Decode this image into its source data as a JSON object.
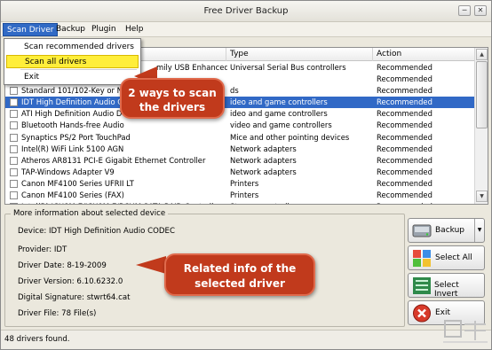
{
  "window": {
    "title": "Free Driver Backup"
  },
  "menu": {
    "items": [
      "Scan Driver",
      "Backup",
      "Plugin",
      "Help"
    ],
    "dropdown": [
      "Scan recommended drivers",
      "Scan all drivers",
      "Exit"
    ]
  },
  "table": {
    "columns": [
      "",
      "Type",
      "Action"
    ],
    "rows": [
      {
        "name": "",
        "name_tail": "mily USB Enhanced...",
        "type": "Universal Serial Bus controllers",
        "action": "Recommended",
        "selected": false
      },
      {
        "name": "",
        "name_tail": "",
        "type": "",
        "action": "Recommended",
        "selected": false
      },
      {
        "name": "Standard 101/102-Key or N",
        "name_tail": "",
        "type": "ds",
        "action": "Recommended",
        "selected": false
      },
      {
        "name": "IDT High Definition Audio C",
        "name_tail": "",
        "type": "ideo and game controllers",
        "action": "Recommended",
        "selected": true
      },
      {
        "name": "ATI High Definition Audio D",
        "name_tail": "",
        "type": "ideo and game controllers",
        "action": "Recommended",
        "selected": false
      },
      {
        "name": "Bluetooth Hands-free Audio",
        "name_tail": "",
        "type": "video and game controllers",
        "action": "Recommended",
        "selected": false
      },
      {
        "name": "Synaptics PS/2 Port TouchPad",
        "name_tail": "",
        "type": "Mice and other pointing devices",
        "action": "Recommended",
        "selected": false
      },
      {
        "name": "Intel(R) WiFi Link 5100 AGN",
        "name_tail": "",
        "type": "Network adapters",
        "action": "Recommended",
        "selected": false
      },
      {
        "name": "Atheros AR8131 PCI-E Gigabit Ethernet Controller",
        "name_tail": "",
        "type": "Network adapters",
        "action": "Recommended",
        "selected": false
      },
      {
        "name": "TAP-Windows Adapter V9",
        "name_tail": "",
        "type": "Network adapters",
        "action": "Recommended",
        "selected": false
      },
      {
        "name": "Canon MF4100 Series UFRII LT",
        "name_tail": "",
        "type": "Printers",
        "action": "Recommended",
        "selected": false
      },
      {
        "name": "Canon MF4100 Series (FAX)",
        "name_tail": "",
        "type": "Printers",
        "action": "Recommended",
        "selected": false
      },
      {
        "name": "Intel(R) ICH8M-E/ICH9M-E/RCHM SATA RAID Controller",
        "name_tail": "",
        "type": "Storage controllers",
        "action": "Recommended",
        "selected": false
      }
    ]
  },
  "info": {
    "legend": "More information about selected device",
    "device": "Device:  IDT High Definition Audio CODEC",
    "provider": "Provider: IDT",
    "date": "Driver Date: 8-19-2009",
    "version": "Driver Version: 6.10.6232.0",
    "signature": "Digital Signature: stwrt64.cat",
    "files": "Driver File: 78 File(s)"
  },
  "buttons": {
    "backup": "Backup",
    "select_all": "Select All",
    "select_invert": "Select Invert",
    "exit": "Exit"
  },
  "status": "48 drivers found.",
  "callouts": {
    "scan": [
      "2 ways to scan",
      "the drivers"
    ],
    "info": [
      "Related info of the",
      "selected driver"
    ]
  },
  "colors": {
    "accent": "#316ac5",
    "callout": "#c13a1c",
    "highlight": "#ffee3a"
  }
}
